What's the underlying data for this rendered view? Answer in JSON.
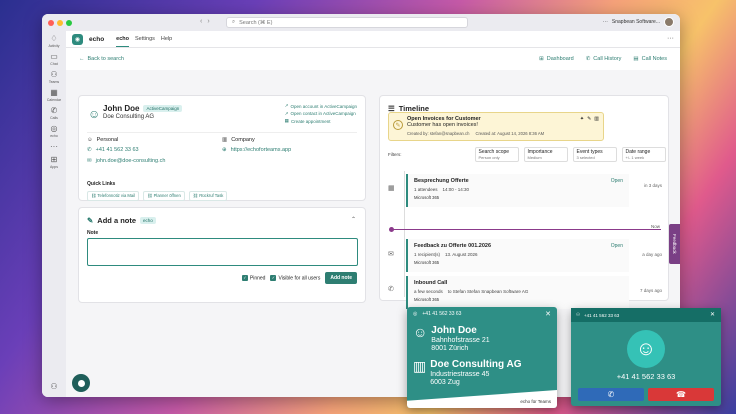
{
  "titlebar": {
    "search_placeholder": "Search (⌘ E)",
    "user_label": "Snapbean Software..."
  },
  "rail": [
    {
      "label": "Activity",
      "icon": "bell-icon"
    },
    {
      "label": "Chat",
      "icon": "chat-icon"
    },
    {
      "label": "Teams",
      "icon": "teams-icon"
    },
    {
      "label": "Calendar",
      "icon": "calendar-icon"
    },
    {
      "label": "Calls",
      "icon": "phone-icon"
    },
    {
      "label": "echo",
      "icon": "echo-icon"
    },
    {
      "label": "",
      "icon": "more-icon"
    },
    {
      "label": "Apps",
      "icon": "apps-icon"
    }
  ],
  "app": {
    "name": "echo",
    "tabs": [
      "echo",
      "Settings",
      "Help"
    ]
  },
  "subbar": {
    "back": "Back to search",
    "dashboard": "Dashboard",
    "call_history": "Call History",
    "call_notes": "Call Notes"
  },
  "contact": {
    "name": "John Doe",
    "badge": "ActiveCampaign",
    "company": "Doe Consulting AG",
    "links": [
      "Open account in ActiveCampaign",
      "Open contact in ActiveCampaign",
      "Create appointment"
    ],
    "personal_label": "Personal",
    "company_label": "Company",
    "phone": "+41 41 562 33 63",
    "website": "https://echoforteams.app",
    "email": "john.doe@doe-consulting.ch",
    "quick_links_label": "Quick Links",
    "quick_links": [
      "Telefonnotiz via Mail",
      "Planner öffnen",
      "Rückruf Task"
    ]
  },
  "note": {
    "title": "Add a note",
    "badge": "echo",
    "label": "Note",
    "pinned": "Pinned",
    "visible": "Visible for all users",
    "add": "Add note"
  },
  "timeline": {
    "title": "Timeline",
    "alert": {
      "title": "Open Invoices for Customer",
      "subtitle": "Customer has open invoices!",
      "created_by": "Created by: stefan@snapbean.ch",
      "created_at": "Created at: August 14, 2026 8:36 AM"
    },
    "filters_label": "Filters:",
    "filters": [
      {
        "title": "Search scope",
        "value": "Person only"
      },
      {
        "title": "Importance",
        "value": "Medium"
      },
      {
        "title": "Event types",
        "value": "3 selected"
      },
      {
        "title": "Date range",
        "value": "+/- 1 week"
      }
    ],
    "events": [
      {
        "title": "Besprechung Offerte",
        "meta1": "1 attendees",
        "meta2": "14:00 - 14:30",
        "source": "Microsoft 365",
        "action": "Open",
        "time": "in 3 days"
      },
      {
        "title": "Feedback zu Offerte 001.2026",
        "meta1": "1 recipient(s)",
        "meta2": "13. August 2026",
        "source": "Microsoft 365",
        "action": "Open",
        "time": "a day ago"
      },
      {
        "title": "Inbound Call",
        "meta1": "a few seconds",
        "meta2": "to Stefan Stefan Snapbean Software AG",
        "source": "Microsoft 365",
        "action": "",
        "time": "7 days ago"
      }
    ],
    "now_label": "Now"
  },
  "feedback": "Feedback",
  "popup": {
    "number": "+41 41 562 33 63",
    "name": "John Doe",
    "street": "Bahnhofstrasse 21",
    "city": "8001 Zürich",
    "company": "Doe Consulting AG",
    "company_street": "Industriestrasse 45",
    "company_city": "6003 Zug",
    "footer": "echo für Teams"
  },
  "call": {
    "header": "+41 41 562 33 63",
    "number": "+41 41 562 33 63"
  }
}
